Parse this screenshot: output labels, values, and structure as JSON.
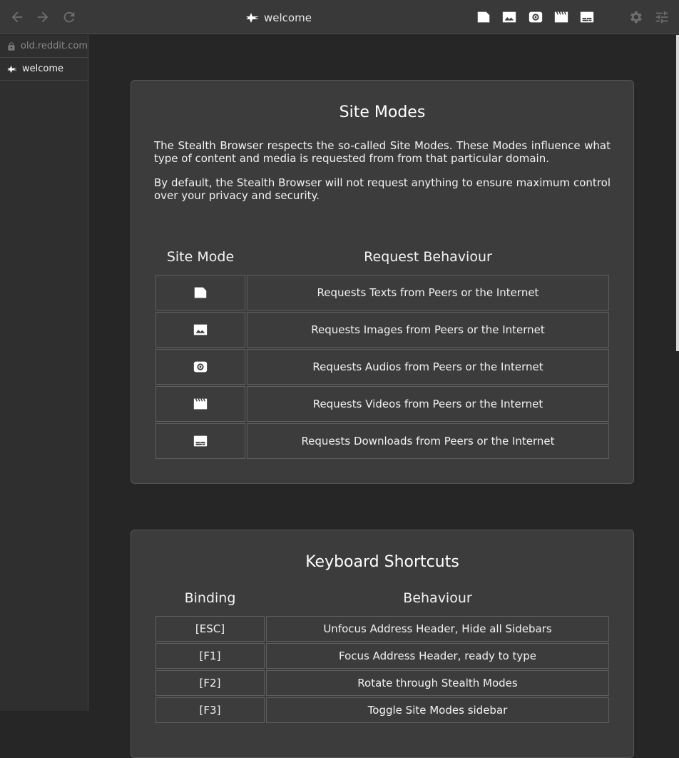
{
  "header": {
    "title": "welcome",
    "icons": {
      "back": "arrow-left-icon",
      "forward": "arrow-right-icon",
      "reload": "refresh-icon",
      "modes": [
        "text-mode-icon",
        "image-mode-icon",
        "audio-mode-icon",
        "video-mode-icon",
        "download-mode-icon"
      ],
      "settings": "gear-icon",
      "tune": "sliders-icon"
    }
  },
  "sidebar": {
    "tabs": [
      {
        "label": "old.reddit.com",
        "icon": "lock-icon",
        "active": false
      },
      {
        "label": "welcome",
        "icon": "stealth-favicon-icon",
        "active": true
      }
    ]
  },
  "site_modes": {
    "title": "Site Modes",
    "para1": "The Stealth Browser respects the so-called Site Modes. These Modes influence what type of content and media is requested from from that particular domain.",
    "para2": "By default, the Stealth Browser will not request anything to ensure maximum control over your privacy and security.",
    "col_mode": "Site Mode",
    "col_behaviour": "Request Behaviour",
    "rows": [
      {
        "icon": "text-mode-icon",
        "behaviour": "Requests Texts from Peers or the Internet"
      },
      {
        "icon": "image-mode-icon",
        "behaviour": "Requests Images from Peers or the Internet"
      },
      {
        "icon": "audio-mode-icon",
        "behaviour": "Requests Audios from Peers or the Internet"
      },
      {
        "icon": "video-mode-icon",
        "behaviour": "Requests Videos from Peers or the Internet"
      },
      {
        "icon": "download-mode-icon",
        "behaviour": "Requests Downloads from Peers or the Internet"
      }
    ]
  },
  "shortcuts": {
    "title": "Keyboard Shortcuts",
    "col_binding": "Binding",
    "col_behaviour": "Behaviour",
    "rows": [
      {
        "binding": "[ESC]",
        "behaviour": "Unfocus Address Header, Hide all Sidebars"
      },
      {
        "binding": "[F1]",
        "behaviour": "Focus Address Header, ready to type"
      },
      {
        "binding": "[F2]",
        "behaviour": "Rotate through Stealth Modes"
      },
      {
        "binding": "[F3]",
        "behaviour": "Toggle Site Modes sidebar"
      }
    ]
  },
  "colors": {
    "header_bg": "#393939",
    "sidebar_bg": "#2f2f2f",
    "main_bg": "#262626",
    "card_bg": "#3c3c3c",
    "icon_dim": "#6e6e6e",
    "icon_bright": "#ffffff"
  }
}
